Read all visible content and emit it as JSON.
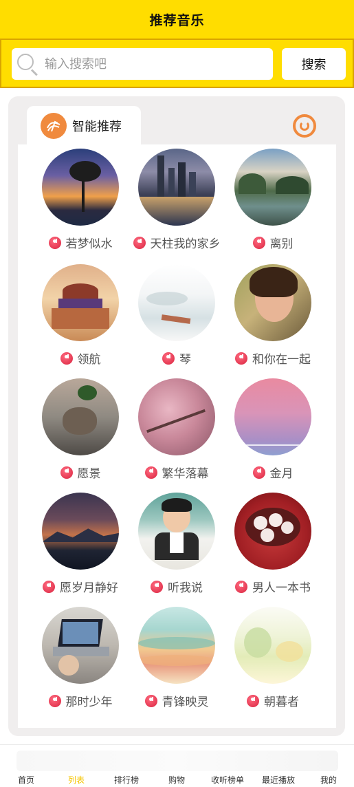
{
  "header": {
    "title": "推荐音乐"
  },
  "search": {
    "placeholder": "输入搜索吧",
    "button_label": "搜索"
  },
  "section": {
    "tab_label": "智能推荐"
  },
  "songs": [
    {
      "title": "若梦似水"
    },
    {
      "title": "天柱我的家乡"
    },
    {
      "title": "离别"
    },
    {
      "title": "领航"
    },
    {
      "title": "琴"
    },
    {
      "title": "和你在一起"
    },
    {
      "title": "愿景"
    },
    {
      "title": "繁华落幕"
    },
    {
      "title": "金月"
    },
    {
      "title": "愿岁月静好"
    },
    {
      "title": "听我说"
    },
    {
      "title": "男人一本书"
    },
    {
      "title": "那时少年"
    },
    {
      "title": "青锋映灵"
    },
    {
      "title": "朝暮者"
    }
  ],
  "bottom_nav": [
    {
      "label": "首页"
    },
    {
      "label": "列表"
    },
    {
      "label": "排行榜"
    },
    {
      "label": "购物"
    },
    {
      "label": "收听榜单"
    },
    {
      "label": "最近播放"
    },
    {
      "label": "我的"
    }
  ],
  "colors": {
    "header_bg": "#ffdd00",
    "accent_orange": "#f08a3e",
    "note_red": "#d9233f",
    "active_nav": "#f5c400"
  },
  "icons": {
    "search": "search-icon",
    "tab_badge": "music-wave-icon",
    "refresh": "refresh-icon",
    "song_marker": "music-note-icon"
  }
}
